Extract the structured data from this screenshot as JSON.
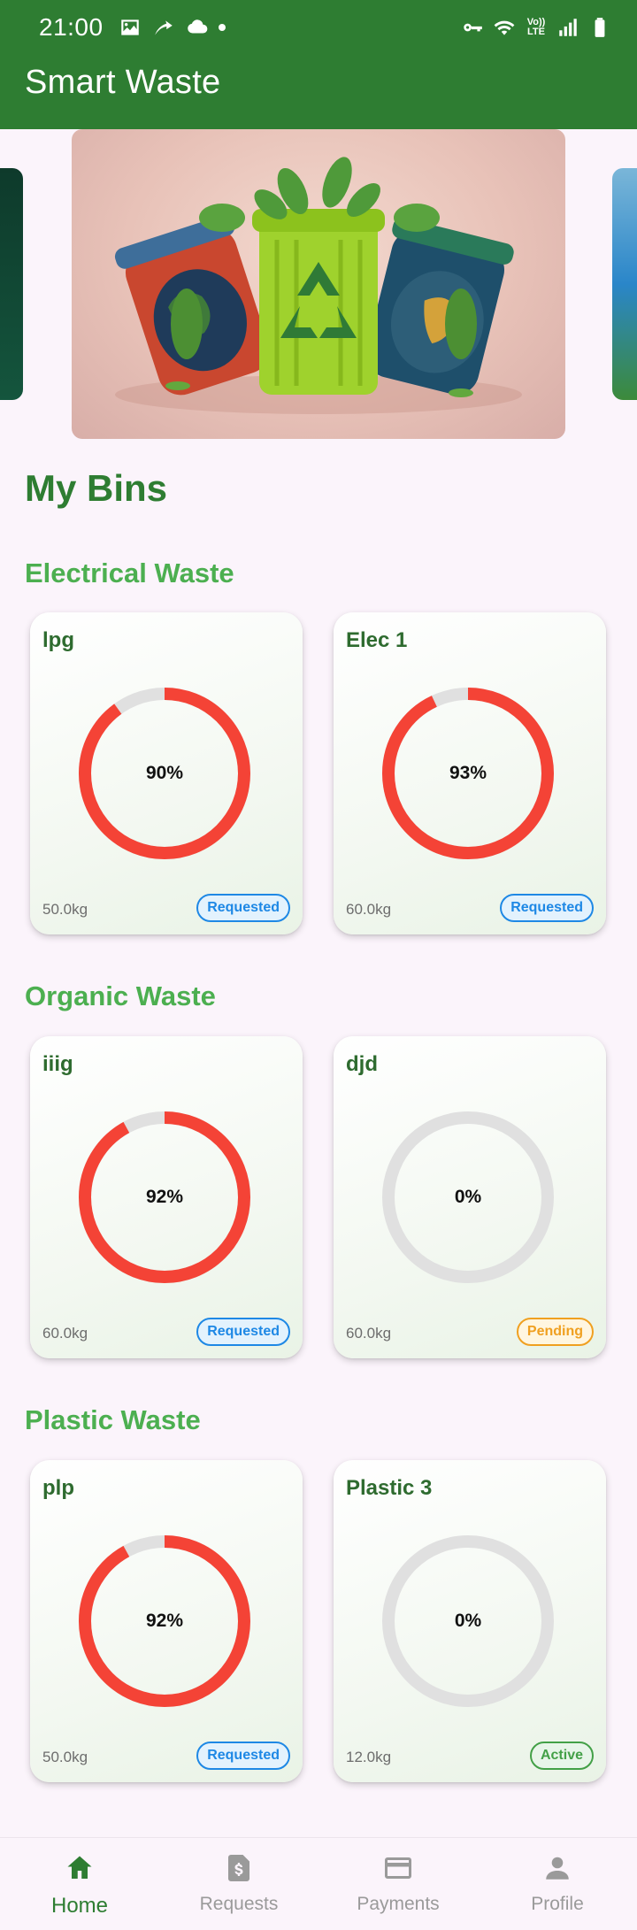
{
  "status_bar": {
    "time": "21:00",
    "icons": [
      "gallery-icon",
      "cast-icon",
      "cloud-icon",
      "dot-icon",
      "vpn-key-icon",
      "wifi-icon",
      "volte-icon",
      "signal-icon",
      "battery-icon"
    ],
    "volte_top": "Vo))",
    "volte_bottom": "LTE"
  },
  "app_bar": {
    "title": "Smart Waste"
  },
  "carousel": {
    "items": [
      "left-banner",
      "recycling-bins-banner",
      "right-banner"
    ]
  },
  "page_heading": "My Bins",
  "colors": {
    "primary": "#2e7d32",
    "section_heading": "#4caf50",
    "gauge_fill": "#f44336",
    "gauge_track": "#e0e0e0",
    "requested": "#1e88e5",
    "pending": "#f0a020",
    "active": "#43a047"
  },
  "sections": [
    {
      "title": "Electrical Waste",
      "bins": [
        {
          "name": "lpg",
          "fill_percent": 90,
          "percent_label": "90%",
          "weight": "50.0kg",
          "status": "Requested",
          "status_type": "requested"
        },
        {
          "name": "Elec 1",
          "fill_percent": 93,
          "percent_label": "93%",
          "weight": "60.0kg",
          "status": "Requested",
          "status_type": "requested"
        }
      ]
    },
    {
      "title": "Organic Waste",
      "bins": [
        {
          "name": "iiig",
          "fill_percent": 92,
          "percent_label": "92%",
          "weight": "60.0kg",
          "status": "Requested",
          "status_type": "requested"
        },
        {
          "name": "djd",
          "fill_percent": 0,
          "percent_label": "0%",
          "weight": "60.0kg",
          "status": "Pending",
          "status_type": "pending"
        }
      ]
    },
    {
      "title": "Plastic Waste",
      "bins": [
        {
          "name": "plp",
          "fill_percent": 92,
          "percent_label": "92%",
          "weight": "50.0kg",
          "status": "Requested",
          "status_type": "requested"
        },
        {
          "name": "Plastic 3",
          "fill_percent": 0,
          "percent_label": "0%",
          "weight": "12.0kg",
          "status": "Active",
          "status_type": "active"
        }
      ]
    }
  ],
  "bottom_nav": {
    "items": [
      {
        "label": "Home",
        "icon": "home-icon",
        "active": true
      },
      {
        "label": "Requests",
        "icon": "receipt-dollar-icon",
        "active": false
      },
      {
        "label": "Payments",
        "icon": "credit-card-icon",
        "active": false
      },
      {
        "label": "Profile",
        "icon": "person-icon",
        "active": false
      }
    ]
  }
}
